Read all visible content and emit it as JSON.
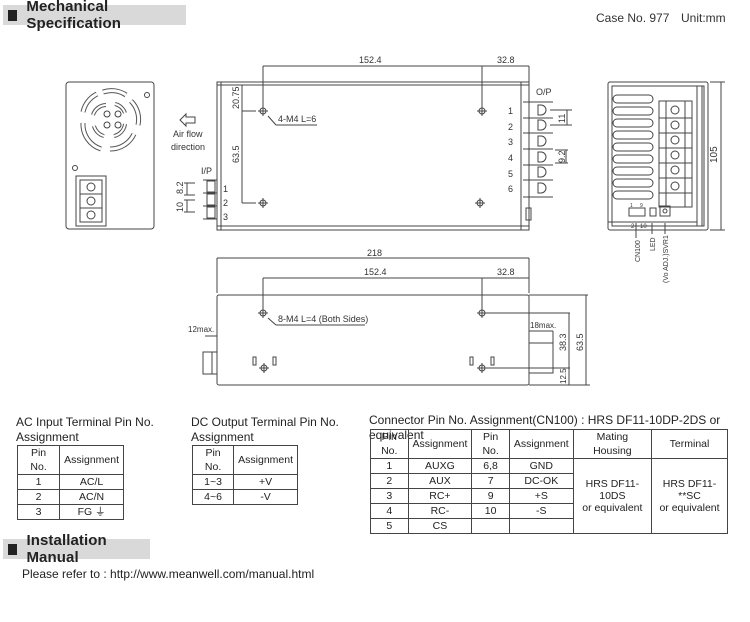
{
  "sections": {
    "mechanical": "Mechanical Specification",
    "installation": "Installation Manual"
  },
  "meta": {
    "case_no": "Case No. 977",
    "unit": "Unit:mm"
  },
  "drawing": {
    "top_view": {
      "dim_top_left": "152.4",
      "dim_top_right": "32.8",
      "dim_vert_top": "20.75",
      "dim_vert_mid": "63.5",
      "screw_label": "4-M4 L=6",
      "ip_label": "I/P",
      "ip_pins": [
        "1",
        "2",
        "3"
      ],
      "ip_dim_a": "8.2",
      "ip_dim_b": "10",
      "op_label": "O/P",
      "op_pins": [
        "1",
        "2",
        "3",
        "4",
        "5",
        "6"
      ],
      "op_dim_a": "11",
      "op_dim_b": "9.2"
    },
    "airflow": {
      "line1": "Air flow",
      "line2": "direction"
    },
    "right_view": {
      "height_dim": "105",
      "labels": [
        "CN100",
        "LED",
        "(Vo ADJ.)SVR1"
      ],
      "cn_pin_top": [
        "1",
        "9"
      ],
      "cn_pin_bottom": [
        "2",
        "10"
      ]
    },
    "side_view": {
      "dim_total": "218",
      "dim_left": "152.4",
      "dim_right": "32.8",
      "screw_label": "8-M4 L=4 (Both Sides)",
      "left_max": "12max.",
      "right_max": "18max.",
      "dim_38": "38.3",
      "dim_12": "12.5",
      "dim_635": "63.5"
    }
  },
  "ac_table": {
    "title_line1": "AC Input Terminal Pin No.",
    "title_line2": "Assignment",
    "headers": [
      "Pin No.",
      "Assignment"
    ],
    "rows": [
      [
        "1",
        "AC/L"
      ],
      [
        "2",
        "AC/N"
      ],
      [
        "3",
        "FG ⏚"
      ]
    ]
  },
  "dc_table": {
    "title_line1": "DC Output Terminal Pin No.",
    "title_line2": "Assignment",
    "headers": [
      "Pin No.",
      "Assignment"
    ],
    "rows": [
      [
        "1~3",
        "+V"
      ],
      [
        "4~6",
        "-V"
      ]
    ]
  },
  "cn_table": {
    "title": "Connector Pin No. Assignment(CN100) : HRS DF11-10DP-2DS or equivalent",
    "headers": [
      "Pin No.",
      "Assignment",
      "Pin No.",
      "Assignment",
      "Mating Housing",
      "Terminal"
    ],
    "rows": [
      [
        "1",
        "AUXG",
        "6,8",
        "GND"
      ],
      [
        "2",
        "AUX",
        "7",
        "DC-OK"
      ],
      [
        "3",
        "RC+",
        "9",
        "+S"
      ],
      [
        "4",
        "RC-",
        "10",
        "-S"
      ],
      [
        "5",
        "CS",
        "",
        ""
      ]
    ],
    "housing_line1": "HRS DF11-10DS",
    "housing_line2": "or equivalent",
    "terminal_line1": "HRS DF11-**SC",
    "terminal_line2": "or equivalent"
  },
  "installation": {
    "text": "Please refer to : http://www.meanwell.com/manual.html"
  }
}
